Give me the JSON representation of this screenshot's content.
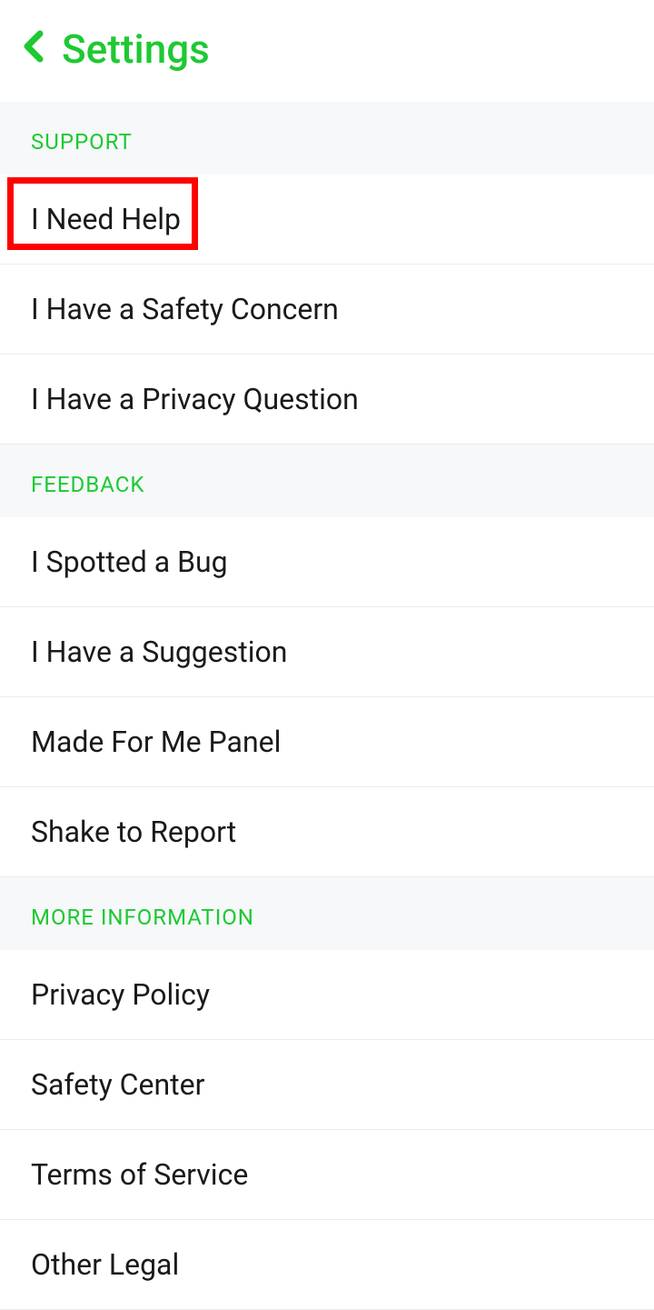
{
  "header": {
    "title": "Settings"
  },
  "sections": {
    "support": {
      "label": "SUPPORT",
      "items": [
        "I Need Help",
        "I Have a Safety Concern",
        "I Have a Privacy Question"
      ]
    },
    "feedback": {
      "label": "FEEDBACK",
      "items": [
        "I Spotted a Bug",
        "I Have a Suggestion",
        "Made For Me Panel",
        "Shake to Report"
      ]
    },
    "more_info": {
      "label": "MORE INFORMATION",
      "items": [
        "Privacy Policy",
        "Safety Center",
        "Terms of Service",
        "Other Legal"
      ]
    }
  },
  "colors": {
    "accent": "#1ec932",
    "highlight": "#ff0000"
  }
}
